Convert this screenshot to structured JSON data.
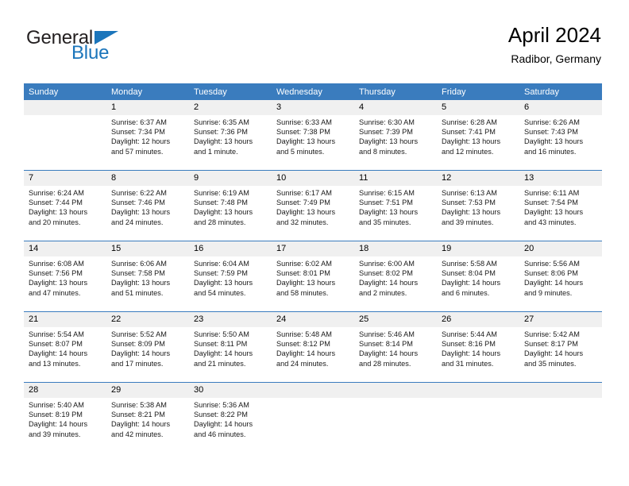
{
  "brand": {
    "name_part1": "General",
    "name_part2": "Blue",
    "accent_color": "#1b75bb"
  },
  "header": {
    "title": "April 2024",
    "location": "Radibor, Germany"
  },
  "theme": {
    "header_row_color": "#3a7cbe",
    "daynum_band_color": "#f0f0f0",
    "row_divider_color": "#3a7cbe"
  },
  "weekday_headers": [
    "Sunday",
    "Monday",
    "Tuesday",
    "Wednesday",
    "Thursday",
    "Friday",
    "Saturday"
  ],
  "weeks": [
    [
      {
        "day": "",
        "lines": [],
        "empty": true
      },
      {
        "day": "1",
        "lines": [
          "Sunrise: 6:37 AM",
          "Sunset: 7:34 PM",
          "Daylight: 12 hours",
          "and 57 minutes."
        ]
      },
      {
        "day": "2",
        "lines": [
          "Sunrise: 6:35 AM",
          "Sunset: 7:36 PM",
          "Daylight: 13 hours",
          "and 1 minute."
        ]
      },
      {
        "day": "3",
        "lines": [
          "Sunrise: 6:33 AM",
          "Sunset: 7:38 PM",
          "Daylight: 13 hours",
          "and 5 minutes."
        ]
      },
      {
        "day": "4",
        "lines": [
          "Sunrise: 6:30 AM",
          "Sunset: 7:39 PM",
          "Daylight: 13 hours",
          "and 8 minutes."
        ]
      },
      {
        "day": "5",
        "lines": [
          "Sunrise: 6:28 AM",
          "Sunset: 7:41 PM",
          "Daylight: 13 hours",
          "and 12 minutes."
        ]
      },
      {
        "day": "6",
        "lines": [
          "Sunrise: 6:26 AM",
          "Sunset: 7:43 PM",
          "Daylight: 13 hours",
          "and 16 minutes."
        ]
      }
    ],
    [
      {
        "day": "7",
        "lines": [
          "Sunrise: 6:24 AM",
          "Sunset: 7:44 PM",
          "Daylight: 13 hours",
          "and 20 minutes."
        ]
      },
      {
        "day": "8",
        "lines": [
          "Sunrise: 6:22 AM",
          "Sunset: 7:46 PM",
          "Daylight: 13 hours",
          "and 24 minutes."
        ]
      },
      {
        "day": "9",
        "lines": [
          "Sunrise: 6:19 AM",
          "Sunset: 7:48 PM",
          "Daylight: 13 hours",
          "and 28 minutes."
        ]
      },
      {
        "day": "10",
        "lines": [
          "Sunrise: 6:17 AM",
          "Sunset: 7:49 PM",
          "Daylight: 13 hours",
          "and 32 minutes."
        ]
      },
      {
        "day": "11",
        "lines": [
          "Sunrise: 6:15 AM",
          "Sunset: 7:51 PM",
          "Daylight: 13 hours",
          "and 35 minutes."
        ]
      },
      {
        "day": "12",
        "lines": [
          "Sunrise: 6:13 AM",
          "Sunset: 7:53 PM",
          "Daylight: 13 hours",
          "and 39 minutes."
        ]
      },
      {
        "day": "13",
        "lines": [
          "Sunrise: 6:11 AM",
          "Sunset: 7:54 PM",
          "Daylight: 13 hours",
          "and 43 minutes."
        ]
      }
    ],
    [
      {
        "day": "14",
        "lines": [
          "Sunrise: 6:08 AM",
          "Sunset: 7:56 PM",
          "Daylight: 13 hours",
          "and 47 minutes."
        ]
      },
      {
        "day": "15",
        "lines": [
          "Sunrise: 6:06 AM",
          "Sunset: 7:58 PM",
          "Daylight: 13 hours",
          "and 51 minutes."
        ]
      },
      {
        "day": "16",
        "lines": [
          "Sunrise: 6:04 AM",
          "Sunset: 7:59 PM",
          "Daylight: 13 hours",
          "and 54 minutes."
        ]
      },
      {
        "day": "17",
        "lines": [
          "Sunrise: 6:02 AM",
          "Sunset: 8:01 PM",
          "Daylight: 13 hours",
          "and 58 minutes."
        ]
      },
      {
        "day": "18",
        "lines": [
          "Sunrise: 6:00 AM",
          "Sunset: 8:02 PM",
          "Daylight: 14 hours",
          "and 2 minutes."
        ]
      },
      {
        "day": "19",
        "lines": [
          "Sunrise: 5:58 AM",
          "Sunset: 8:04 PM",
          "Daylight: 14 hours",
          "and 6 minutes."
        ]
      },
      {
        "day": "20",
        "lines": [
          "Sunrise: 5:56 AM",
          "Sunset: 8:06 PM",
          "Daylight: 14 hours",
          "and 9 minutes."
        ]
      }
    ],
    [
      {
        "day": "21",
        "lines": [
          "Sunrise: 5:54 AM",
          "Sunset: 8:07 PM",
          "Daylight: 14 hours",
          "and 13 minutes."
        ]
      },
      {
        "day": "22",
        "lines": [
          "Sunrise: 5:52 AM",
          "Sunset: 8:09 PM",
          "Daylight: 14 hours",
          "and 17 minutes."
        ]
      },
      {
        "day": "23",
        "lines": [
          "Sunrise: 5:50 AM",
          "Sunset: 8:11 PM",
          "Daylight: 14 hours",
          "and 21 minutes."
        ]
      },
      {
        "day": "24",
        "lines": [
          "Sunrise: 5:48 AM",
          "Sunset: 8:12 PM",
          "Daylight: 14 hours",
          "and 24 minutes."
        ]
      },
      {
        "day": "25",
        "lines": [
          "Sunrise: 5:46 AM",
          "Sunset: 8:14 PM",
          "Daylight: 14 hours",
          "and 28 minutes."
        ]
      },
      {
        "day": "26",
        "lines": [
          "Sunrise: 5:44 AM",
          "Sunset: 8:16 PM",
          "Daylight: 14 hours",
          "and 31 minutes."
        ]
      },
      {
        "day": "27",
        "lines": [
          "Sunrise: 5:42 AM",
          "Sunset: 8:17 PM",
          "Daylight: 14 hours",
          "and 35 minutes."
        ]
      }
    ],
    [
      {
        "day": "28",
        "lines": [
          "Sunrise: 5:40 AM",
          "Sunset: 8:19 PM",
          "Daylight: 14 hours",
          "and 39 minutes."
        ]
      },
      {
        "day": "29",
        "lines": [
          "Sunrise: 5:38 AM",
          "Sunset: 8:21 PM",
          "Daylight: 14 hours",
          "and 42 minutes."
        ]
      },
      {
        "day": "30",
        "lines": [
          "Sunrise: 5:36 AM",
          "Sunset: 8:22 PM",
          "Daylight: 14 hours",
          "and 46 minutes."
        ]
      },
      {
        "day": "",
        "lines": [],
        "empty": true
      },
      {
        "day": "",
        "lines": [],
        "empty": true
      },
      {
        "day": "",
        "lines": [],
        "empty": true
      },
      {
        "day": "",
        "lines": [],
        "empty": true
      }
    ]
  ]
}
